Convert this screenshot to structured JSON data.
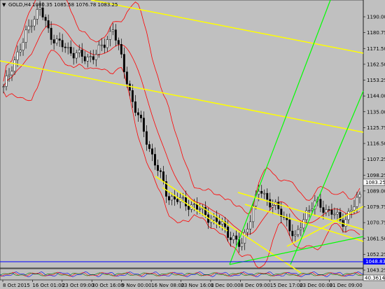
{
  "header": {
    "dropdown_glyph": "▼",
    "symbol": "GOLD,H4",
    "ohlc": "1080.35 1085.58 1076.78 1083.25"
  },
  "price_axis": {
    "labels": [
      "1190.00",
      "1180.75",
      "1171.50",
      "1162.50",
      "1153.25",
      "1144.00",
      "1135.00",
      "1125.75",
      "1116.50",
      "1107.25",
      "1098.25",
      "1089.00",
      "1079.75",
      "1070.75",
      "1061.50",
      "1052.25",
      "1043.25"
    ],
    "current_price_tag": "1083.25",
    "hline_tag": "1048.83"
  },
  "time_axis": {
    "labels": [
      "8 Oct 2015",
      "16 Oct 01:00",
      "23 Oct 09:00",
      "30 Oct 16:00",
      "9 Nov 00:00",
      "16 Nov 08:00",
      "23 Nov 16:00",
      "1 Dec 00:00",
      "8 Dec 09:00",
      "15 Dec 17:00",
      "23 Dec 00:00",
      "31 Dec 09:00"
    ]
  },
  "subwindow": {
    "value_tag": "40.3614"
  },
  "colors": {
    "background": "#c0c0c0",
    "candle": "#000000",
    "bands": "#ff0000",
    "channel_yellow": "#ffff00",
    "fan_green": "#00ff00",
    "hline_blue": "#0000ff"
  },
  "chart_data": {
    "type": "line",
    "symbol": "GOLD",
    "timeframe": "H4",
    "series": [
      {
        "values": [
          1145,
          1160,
          1170,
          1185,
          1192,
          1178,
          1172,
          1168,
          1166,
          1162,
          1166,
          1170,
          1182,
          1160,
          1140,
          1125,
          1110,
          1096,
          1082,
          1080,
          1078,
          1076,
          1072,
          1068,
          1065,
          1058,
          1052,
          1070,
          1086,
          1080,
          1074,
          1068,
          1056,
          1072,
          1078,
          1075,
          1073,
          1066,
          1074,
          1081
        ]
      }
    ],
    "ylim": [
      1040,
      1196
    ],
    "horizontal_line": 1048.83,
    "last_price": 1083.25
  }
}
